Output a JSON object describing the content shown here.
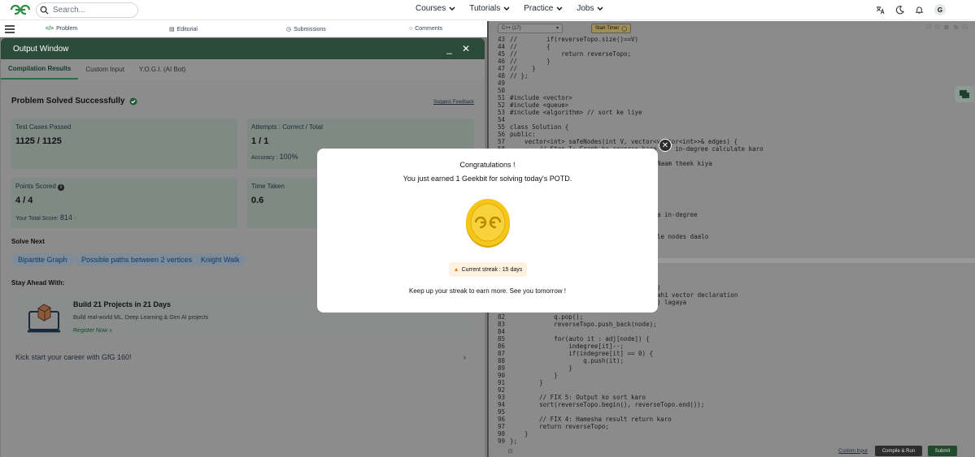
{
  "nav": {
    "search_placeholder": "Search...",
    "links": [
      "Courses",
      "Tutorials",
      "Practice",
      "Jobs"
    ],
    "avatar_initial": "G"
  },
  "tabs": {
    "problem": "Problem",
    "editorial": "Editorial",
    "submissions": "Submissions",
    "comments": "Comments"
  },
  "output": {
    "title": "Output Window",
    "tabs": [
      "Compilation Results",
      "Custom Input",
      "Y.O.G.I. (AI Bot)"
    ],
    "status": "Problem Solved Successfully",
    "suggest_feedback": "Suggest Feedback",
    "test_cases_label": "Test Cases Passed",
    "test_cases_value": "1125 / 1125",
    "attempts_label": "Attempts : Correct / Total",
    "attempts_value": "1 / 1",
    "accuracy_label": "Accuracy :",
    "accuracy_value": "100%",
    "points_label": "Points Scored",
    "points_value": "4 / 4",
    "total_score_label": "Your Total Score:",
    "total_score_value": "814",
    "time_label": "Time Taken",
    "time_value": "0.6",
    "solve_next": "Solve Next",
    "next_problems": [
      "Bipartite Graph",
      "Possible paths between 2 vertices",
      "Knight Walk"
    ],
    "stay_ahead": "Stay Ahead With:",
    "promo_title": "Build 21 Projects in 21 Days",
    "promo_desc": "Build real-world ML, Deep Learning & Gen AI projects",
    "promo_cta": "Register Now »",
    "kickstart": "Kick start your career with GfG 160!"
  },
  "editor": {
    "language": "C++ (17)",
    "timer": "Start Timer",
    "lines": [
      {
        "n": "43",
        "code": "//        if(reverseTopo.size()==V)"
      },
      {
        "n": "44",
        "code": "//        {"
      },
      {
        "n": "45",
        "code": "//            return reverseTopo;"
      },
      {
        "n": "46",
        "code": "//        }"
      },
      {
        "n": "47",
        "code": "//    }"
      },
      {
        "n": "48",
        "code": "// };"
      },
      {
        "n": "49",
        "code": ""
      },
      {
        "n": "50",
        "code": ""
      },
      {
        "n": "51",
        "code": "#include <vector>"
      },
      {
        "n": "52",
        "code": "#include <queue>"
      },
      {
        "n": "53",
        "code": "#include <algorithm> // sort ke liye"
      },
      {
        "n": "54",
        "code": ""
      },
      {
        "n": "55",
        "code": "class Solution {"
      },
      {
        "n": "56",
        "code": "public:"
      },
      {
        "n": "57",
        "code": "    vector<int> safeNodes(int V, vector<vector<int>>& edges) {"
      },
      {
        "n": "58",
        "code": "        // Step 1: Graph ko reverse karo aur in-degree calculate karo"
      }
    ],
    "partial_lines": [
      {
        "n": "",
        "code": "Naam theek kiya",
        "row": 17
      },
      {
        "n": "",
        "code": "a in-degree",
        "row": 24
      },
      {
        "n": "",
        "code": "le nodes daalo",
        "row": 27
      },
      {
        "n": "",
        "code": ")",
        "row": 34
      },
      {
        "n": "",
        "code": "ahi vector declaration",
        "row": 35
      },
      {
        "n": "",
        "code": ") lagaya",
        "row": 36
      }
    ],
    "lower_lines": [
      {
        "n": "82",
        "code": "            q.pop();"
      },
      {
        "n": "83",
        "code": "            reverseTopo.push_back(node);"
      },
      {
        "n": "84",
        "code": ""
      },
      {
        "n": "85",
        "code": "            for(auto it : adj[node]) {"
      },
      {
        "n": "86",
        "code": "                indegree[it]--;"
      },
      {
        "n": "87",
        "code": "                if(indegree[it] == 0) {"
      },
      {
        "n": "88",
        "code": "                    q.push(it);"
      },
      {
        "n": "89",
        "code": "                }"
      },
      {
        "n": "90",
        "code": "            }"
      },
      {
        "n": "91",
        "code": "        }"
      },
      {
        "n": "92",
        "code": ""
      },
      {
        "n": "93",
        "code": "        // FIX 5: Output ko sort karo"
      },
      {
        "n": "94",
        "code": "        sort(reverseTopo.begin(), reverseTopo.end());"
      },
      {
        "n": "95",
        "code": ""
      },
      {
        "n": "96",
        "code": "        // FIX 4: Hamesha result return karo"
      },
      {
        "n": "97",
        "code": "        return reverseTopo;"
      },
      {
        "n": "98",
        "code": "    }"
      },
      {
        "n": "99",
        "code": "};"
      }
    ],
    "custom_input": "Custom Input",
    "compile_run": "Compile & Run",
    "submit": "Submit"
  },
  "modal": {
    "heading": "Congratulations !",
    "message": "You just earned 1 Geekbit for solving today's POTD.",
    "streak": "Current streak : 15 days",
    "footer": "Keep up your streak to earn more. See you tomorrow !"
  },
  "colors": {
    "brand_green": "#2f8d46",
    "submit_green": "#1f6b35",
    "coin_gold": "#f5c518"
  }
}
